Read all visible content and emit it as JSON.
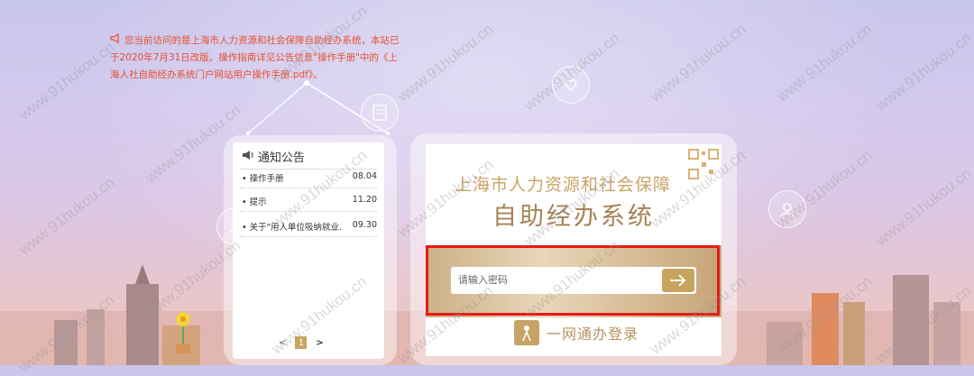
{
  "notice": {
    "text": "您当前访问的是上海市人力资源和社会保障自助经办系统，本站已于2020年7月31日改版。操作指南详见公告信息\"操作手册\"中的《上海人社自助经办系统门户网站用户操作手册.pdf》。"
  },
  "news": {
    "title": "通知公告",
    "items": [
      {
        "title": "操作手册",
        "date": "08.04"
      },
      {
        "title": "提示",
        "date": "11.20"
      },
      {
        "title": "关于\"用人单位吸纳就业...",
        "date": "09.30"
      }
    ],
    "pager": {
      "prev": "<",
      "current": "1",
      "next": ">"
    }
  },
  "login": {
    "title_line1": "上海市人力资源和社会保障",
    "title_line2": "自助经办系统",
    "password_placeholder": "请输入密码",
    "one_web_label": "一网通办登录"
  },
  "watermark": "www.91hukou.cn",
  "colors": {
    "notice_text": "#e8502f",
    "gold": "#c8a45f",
    "highlight_border": "#e41b14"
  }
}
